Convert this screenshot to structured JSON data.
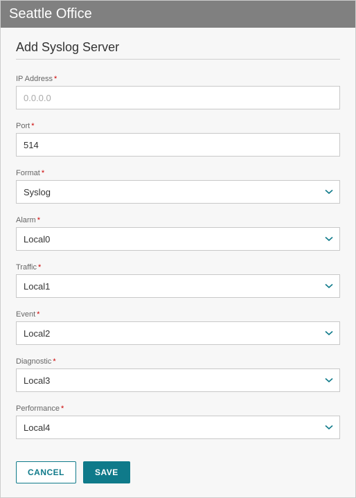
{
  "header": {
    "title": "Seattle Office"
  },
  "page": {
    "title": "Add Syslog Server"
  },
  "fields": {
    "ip_address": {
      "label": "IP Address",
      "placeholder": "0.0.0.0",
      "value": ""
    },
    "port": {
      "label": "Port",
      "value": "514"
    },
    "format": {
      "label": "Format",
      "value": "Syslog"
    },
    "alarm": {
      "label": "Alarm",
      "value": "Local0"
    },
    "traffic": {
      "label": "Traffic",
      "value": "Local1"
    },
    "event": {
      "label": "Event",
      "value": "Local2"
    },
    "diagnostic": {
      "label": "Diagnostic",
      "value": "Local3"
    },
    "performance": {
      "label": "Performance",
      "value": "Local4"
    }
  },
  "buttons": {
    "cancel": "CANCEL",
    "save": "SAVE"
  },
  "required_marker": "*"
}
